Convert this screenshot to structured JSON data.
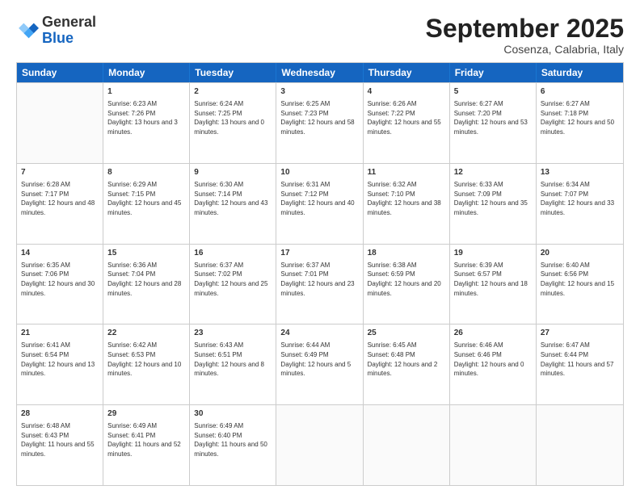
{
  "header": {
    "logo_general": "General",
    "logo_blue": "Blue",
    "title": "September 2025",
    "location": "Cosenza, Calabria, Italy"
  },
  "days": [
    "Sunday",
    "Monday",
    "Tuesday",
    "Wednesday",
    "Thursday",
    "Friday",
    "Saturday"
  ],
  "weeks": [
    [
      {
        "day": "",
        "empty": true
      },
      {
        "day": "1",
        "sunrise": "Sunrise: 6:23 AM",
        "sunset": "Sunset: 7:26 PM",
        "daylight": "Daylight: 13 hours and 3 minutes."
      },
      {
        "day": "2",
        "sunrise": "Sunrise: 6:24 AM",
        "sunset": "Sunset: 7:25 PM",
        "daylight": "Daylight: 13 hours and 0 minutes."
      },
      {
        "day": "3",
        "sunrise": "Sunrise: 6:25 AM",
        "sunset": "Sunset: 7:23 PM",
        "daylight": "Daylight: 12 hours and 58 minutes."
      },
      {
        "day": "4",
        "sunrise": "Sunrise: 6:26 AM",
        "sunset": "Sunset: 7:22 PM",
        "daylight": "Daylight: 12 hours and 55 minutes."
      },
      {
        "day": "5",
        "sunrise": "Sunrise: 6:27 AM",
        "sunset": "Sunset: 7:20 PM",
        "daylight": "Daylight: 12 hours and 53 minutes."
      },
      {
        "day": "6",
        "sunrise": "Sunrise: 6:27 AM",
        "sunset": "Sunset: 7:18 PM",
        "daylight": "Daylight: 12 hours and 50 minutes."
      }
    ],
    [
      {
        "day": "7",
        "sunrise": "Sunrise: 6:28 AM",
        "sunset": "Sunset: 7:17 PM",
        "daylight": "Daylight: 12 hours and 48 minutes."
      },
      {
        "day": "8",
        "sunrise": "Sunrise: 6:29 AM",
        "sunset": "Sunset: 7:15 PM",
        "daylight": "Daylight: 12 hours and 45 minutes."
      },
      {
        "day": "9",
        "sunrise": "Sunrise: 6:30 AM",
        "sunset": "Sunset: 7:14 PM",
        "daylight": "Daylight: 12 hours and 43 minutes."
      },
      {
        "day": "10",
        "sunrise": "Sunrise: 6:31 AM",
        "sunset": "Sunset: 7:12 PM",
        "daylight": "Daylight: 12 hours and 40 minutes."
      },
      {
        "day": "11",
        "sunrise": "Sunrise: 6:32 AM",
        "sunset": "Sunset: 7:10 PM",
        "daylight": "Daylight: 12 hours and 38 minutes."
      },
      {
        "day": "12",
        "sunrise": "Sunrise: 6:33 AM",
        "sunset": "Sunset: 7:09 PM",
        "daylight": "Daylight: 12 hours and 35 minutes."
      },
      {
        "day": "13",
        "sunrise": "Sunrise: 6:34 AM",
        "sunset": "Sunset: 7:07 PM",
        "daylight": "Daylight: 12 hours and 33 minutes."
      }
    ],
    [
      {
        "day": "14",
        "sunrise": "Sunrise: 6:35 AM",
        "sunset": "Sunset: 7:06 PM",
        "daylight": "Daylight: 12 hours and 30 minutes."
      },
      {
        "day": "15",
        "sunrise": "Sunrise: 6:36 AM",
        "sunset": "Sunset: 7:04 PM",
        "daylight": "Daylight: 12 hours and 28 minutes."
      },
      {
        "day": "16",
        "sunrise": "Sunrise: 6:37 AM",
        "sunset": "Sunset: 7:02 PM",
        "daylight": "Daylight: 12 hours and 25 minutes."
      },
      {
        "day": "17",
        "sunrise": "Sunrise: 6:37 AM",
        "sunset": "Sunset: 7:01 PM",
        "daylight": "Daylight: 12 hours and 23 minutes."
      },
      {
        "day": "18",
        "sunrise": "Sunrise: 6:38 AM",
        "sunset": "Sunset: 6:59 PM",
        "daylight": "Daylight: 12 hours and 20 minutes."
      },
      {
        "day": "19",
        "sunrise": "Sunrise: 6:39 AM",
        "sunset": "Sunset: 6:57 PM",
        "daylight": "Daylight: 12 hours and 18 minutes."
      },
      {
        "day": "20",
        "sunrise": "Sunrise: 6:40 AM",
        "sunset": "Sunset: 6:56 PM",
        "daylight": "Daylight: 12 hours and 15 minutes."
      }
    ],
    [
      {
        "day": "21",
        "sunrise": "Sunrise: 6:41 AM",
        "sunset": "Sunset: 6:54 PM",
        "daylight": "Daylight: 12 hours and 13 minutes."
      },
      {
        "day": "22",
        "sunrise": "Sunrise: 6:42 AM",
        "sunset": "Sunset: 6:53 PM",
        "daylight": "Daylight: 12 hours and 10 minutes."
      },
      {
        "day": "23",
        "sunrise": "Sunrise: 6:43 AM",
        "sunset": "Sunset: 6:51 PM",
        "daylight": "Daylight: 12 hours and 8 minutes."
      },
      {
        "day": "24",
        "sunrise": "Sunrise: 6:44 AM",
        "sunset": "Sunset: 6:49 PM",
        "daylight": "Daylight: 12 hours and 5 minutes."
      },
      {
        "day": "25",
        "sunrise": "Sunrise: 6:45 AM",
        "sunset": "Sunset: 6:48 PM",
        "daylight": "Daylight: 12 hours and 2 minutes."
      },
      {
        "day": "26",
        "sunrise": "Sunrise: 6:46 AM",
        "sunset": "Sunset: 6:46 PM",
        "daylight": "Daylight: 12 hours and 0 minutes."
      },
      {
        "day": "27",
        "sunrise": "Sunrise: 6:47 AM",
        "sunset": "Sunset: 6:44 PM",
        "daylight": "Daylight: 11 hours and 57 minutes."
      }
    ],
    [
      {
        "day": "28",
        "sunrise": "Sunrise: 6:48 AM",
        "sunset": "Sunset: 6:43 PM",
        "daylight": "Daylight: 11 hours and 55 minutes."
      },
      {
        "day": "29",
        "sunrise": "Sunrise: 6:49 AM",
        "sunset": "Sunset: 6:41 PM",
        "daylight": "Daylight: 11 hours and 52 minutes."
      },
      {
        "day": "30",
        "sunrise": "Sunrise: 6:49 AM",
        "sunset": "Sunset: 6:40 PM",
        "daylight": "Daylight: 11 hours and 50 minutes."
      },
      {
        "day": "",
        "empty": true
      },
      {
        "day": "",
        "empty": true
      },
      {
        "day": "",
        "empty": true
      },
      {
        "day": "",
        "empty": true
      }
    ]
  ]
}
